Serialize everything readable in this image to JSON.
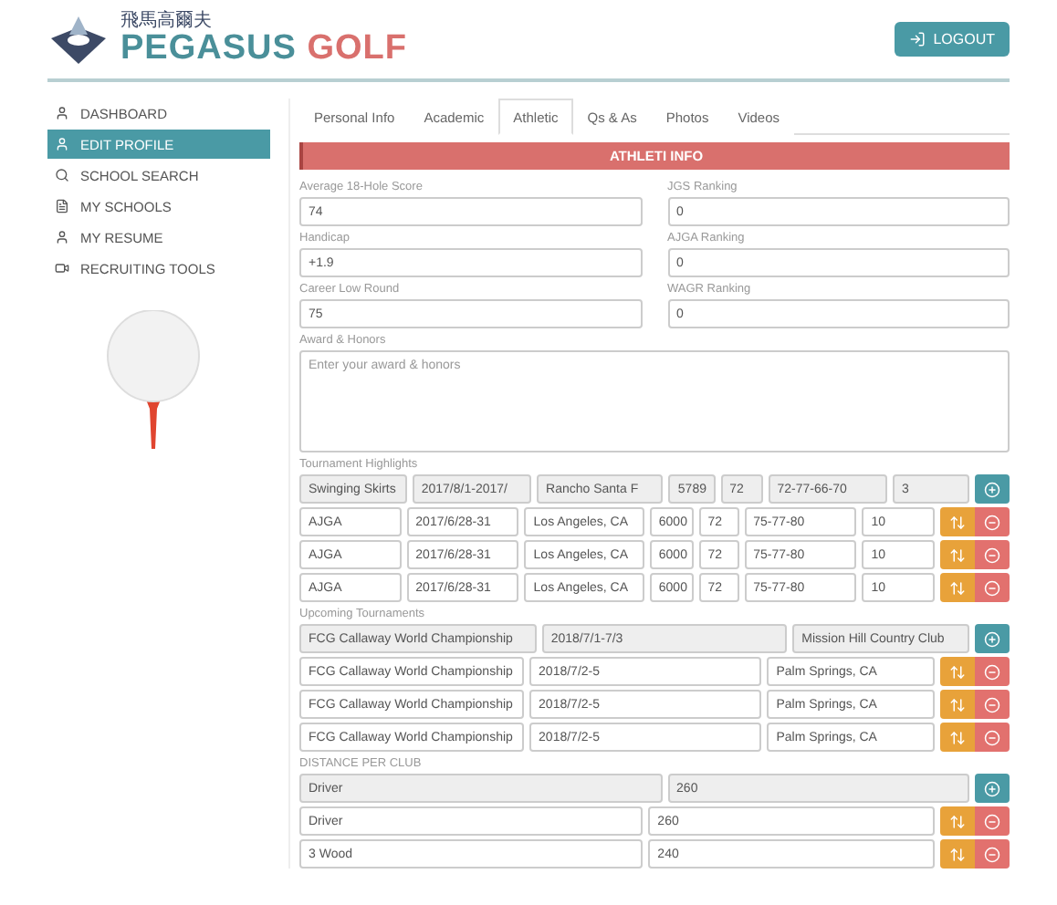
{
  "header": {
    "logo": {
      "tagline": "飛馬高爾夫",
      "brand_primary": "PEGASUS",
      "brand_accent": "GOLF"
    },
    "logout": {
      "label": "LOGOUT"
    }
  },
  "sidebar": {
    "items": [
      {
        "label": "DASHBOARD",
        "selected": false
      },
      {
        "label": "EDIT PROFILE",
        "selected": true
      },
      {
        "label": "SCHOOL SEARCH",
        "selected": false
      },
      {
        "label": "MY SCHOOLS",
        "selected": false
      },
      {
        "label": "MY RESUME",
        "selected": false
      },
      {
        "label": "RECRUITING TOOLS",
        "selected": false
      }
    ]
  },
  "tabs": [
    {
      "label": "Personal Info",
      "selected": false
    },
    {
      "label": "Academic",
      "selected": false
    },
    {
      "label": "Athletic",
      "selected": true
    },
    {
      "label": "Qs & As",
      "selected": false
    },
    {
      "label": "Photos",
      "selected": false
    },
    {
      "label": "Videos",
      "selected": false
    }
  ],
  "section_title": "ATHLETI INFO",
  "fields": [
    {
      "label": "Average 18-Hole Score",
      "value": "74"
    },
    {
      "label": "JGS Ranking",
      "value": "0"
    },
    {
      "label": "Handicap",
      "value": "+1.9"
    },
    {
      "label": "AJGA Ranking",
      "value": "0"
    },
    {
      "label": "Career Low Round",
      "value": "75"
    },
    {
      "label": "WAGR Ranking",
      "value": "0"
    }
  ],
  "awards": {
    "label": "Award & Honors",
    "placeholder": "Enter your award & honors"
  },
  "tables": [
    {
      "label": "Tournament Highlights",
      "rows": [
        {
          "kind": "new",
          "cells": [
            "Swinging Skirts",
            "2017/8/1-2017/",
            "Rancho Santa F",
            "5789",
            "72",
            "72-77-66-70",
            "3"
          ]
        },
        {
          "kind": "saved",
          "cells": [
            "AJGA",
            "2017/6/28-31",
            "Los Angeles, CA",
            "6000",
            "72",
            "75-77-80",
            "10"
          ]
        },
        {
          "kind": "saved",
          "cells": [
            "AJGA",
            "2017/6/28-31",
            "Los Angeles, CA",
            "6000",
            "72",
            "75-77-80",
            "10"
          ]
        },
        {
          "kind": "saved",
          "cells": [
            "AJGA",
            "2017/6/28-31",
            "Los Angeles, CA",
            "6000",
            "72",
            "75-77-80",
            "10"
          ]
        }
      ]
    },
    {
      "label": "Upcoming Tournaments",
      "rows": [
        {
          "kind": "new",
          "cells": [
            "FCG Callaway World Championship",
            "2018/7/1-7/3",
            "Mission Hill Country Club"
          ]
        },
        {
          "kind": "saved",
          "cells": [
            "FCG Callaway World Championship",
            "2018/7/2-5",
            "Palm Springs, CA"
          ]
        },
        {
          "kind": "saved",
          "cells": [
            "FCG Callaway World Championship",
            "2018/7/2-5",
            "Palm Springs, CA"
          ]
        },
        {
          "kind": "saved",
          "cells": [
            "FCG Callaway World Championship",
            "2018/7/2-5",
            "Palm Springs, CA"
          ]
        }
      ]
    },
    {
      "label": "DISTANCE PER CLUB",
      "rows": [
        {
          "kind": "new",
          "cells": [
            "Driver",
            "260"
          ]
        },
        {
          "kind": "saved",
          "cells": [
            "Driver",
            "260"
          ]
        },
        {
          "kind": "saved",
          "cells": [
            "3 Wood",
            "240"
          ]
        }
      ]
    }
  ]
}
